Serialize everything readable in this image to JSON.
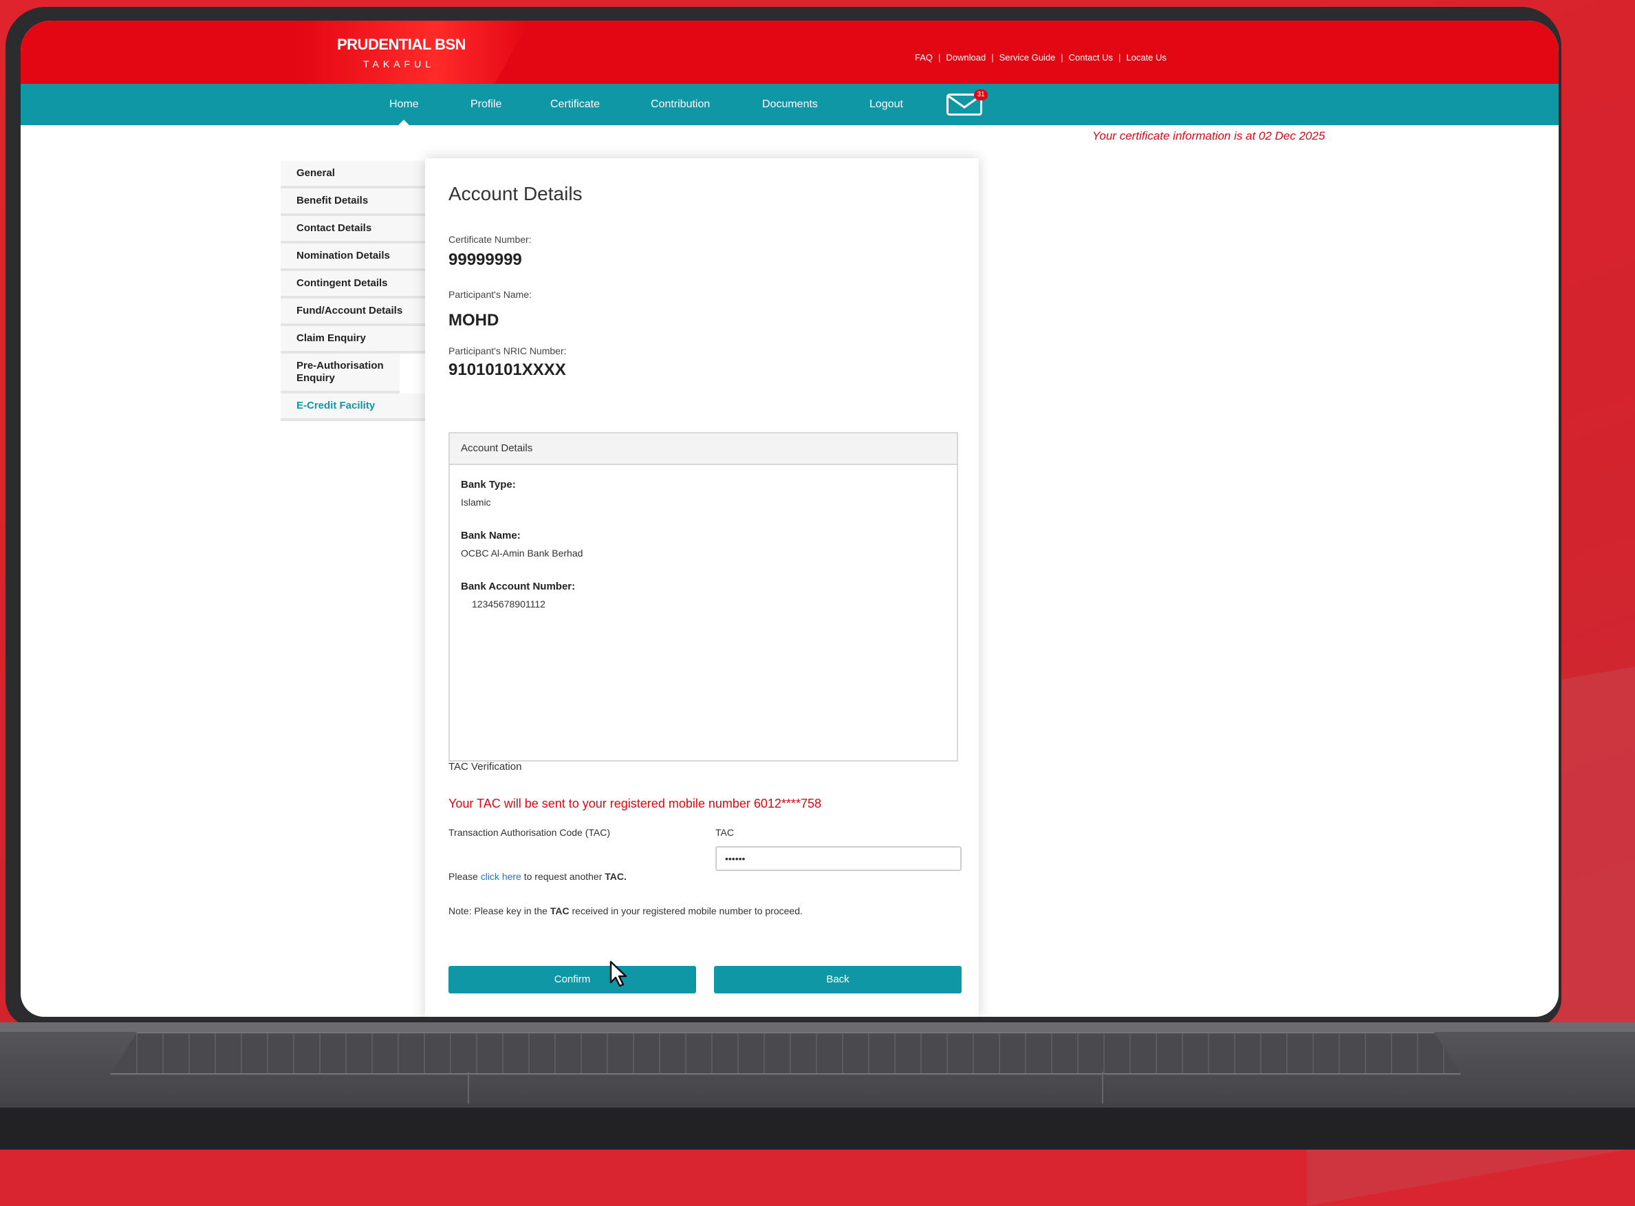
{
  "brand": {
    "name": "PRUDENTIAL BSN",
    "sub": "TAKAFUL"
  },
  "top_links": [
    "FAQ",
    "Download",
    "Service Guide",
    "Contact Us",
    "Locate Us"
  ],
  "nav": {
    "items": [
      "Home",
      "Profile",
      "Certificate",
      "Contribution",
      "Documents",
      "Logout"
    ],
    "active": "Home",
    "mail_count": "31"
  },
  "info_note": "Your certificate information is at 02 Dec 2025",
  "sidebar": {
    "items": [
      "General",
      "Benefit Details",
      "Contact Details",
      "Nomination Details",
      "Contingent Details",
      "Fund/Account Details",
      "Claim Enquiry",
      "Pre-Authorisation Enquiry",
      "E-Credit Facility"
    ],
    "active": "E-Credit Facility"
  },
  "card": {
    "title": "Account Details",
    "cert_label": "Certificate Number:",
    "cert_value": "99999999",
    "name_label": "Participant's Name:",
    "name_value": "MOHD",
    "nric_label": "Participant's NRIC Number:",
    "nric_value": "91010101XXXX"
  },
  "account_box": {
    "header": "Account Details",
    "bank_type_label": "Bank Type:",
    "bank_type_value": "Islamic",
    "bank_name_label": "Bank Name:",
    "bank_name_value": "OCBC Al-Amin Bank Berhad",
    "account_label": "Bank Account Number:",
    "account_value": "12345678901112"
  },
  "tac": {
    "section_title": "TAC Verification",
    "message": "Your TAC will be sent to your registered mobile number 6012****758",
    "code_label": "Transaction Authorisation Code (TAC)",
    "input_label": "TAC",
    "input_value": "••••••",
    "request_prefix": "Please ",
    "request_link": "click here",
    "request_suffix": " to request another ",
    "request_bold": "TAC.",
    "note_prefix": "Note: Please key in the ",
    "note_bold": "TAC",
    "note_suffix": " received in your registered mobile number to proceed."
  },
  "buttons": {
    "confirm": "Confirm",
    "back": "Back"
  }
}
